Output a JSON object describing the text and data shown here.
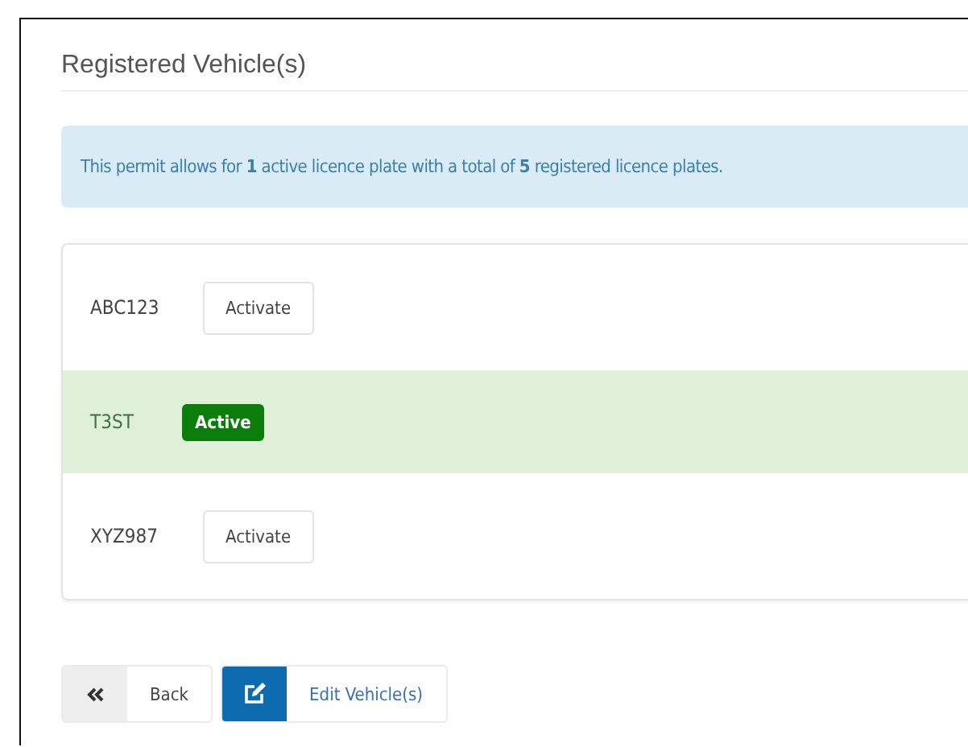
{
  "title": "Registered Vehicle(s)",
  "notice": "This permit allows for **1** active licence plate with a total of **5** registered licence plates.",
  "vehicles": [
    {
      "plate": "ABC123",
      "active": false,
      "action": "Activate"
    },
    {
      "plate": "T3ST",
      "active": true,
      "action": "Active"
    },
    {
      "plate": "XYZ987",
      "active": false,
      "action": "Activate"
    }
  ],
  "buttons": [
    {
      "kind": "back",
      "label": "Back"
    },
    {
      "kind": "edit",
      "label": "Edit Vehicle(s)"
    }
  ]
}
